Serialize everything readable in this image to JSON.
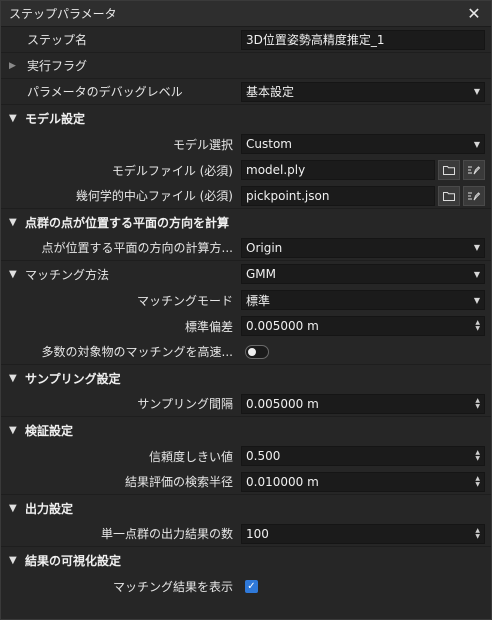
{
  "window": {
    "title": "ステップパラメータ"
  },
  "top": {
    "step_name": {
      "label": "ステップ名",
      "value": "3D位置姿勢高精度推定_1"
    },
    "exec_flag": {
      "label": "実行フラグ"
    },
    "debug_level": {
      "label": "パラメータのデバッグレベル",
      "value": "基本設定"
    }
  },
  "model": {
    "header": "モデル設定",
    "select": {
      "label": "モデル選択",
      "value": "Custom"
    },
    "file": {
      "label": "モデルファイル (必須)",
      "value": "model.ply"
    },
    "center": {
      "label": "幾何学的中心ファイル (必須)",
      "value": "pickpoint.json"
    }
  },
  "plane": {
    "header": "点群の点が位置する平面の方向を計算",
    "method": {
      "label": "点が位置する平面の方向の計算方...",
      "value": "Origin"
    }
  },
  "matching": {
    "label": "マッチング方法",
    "value": "GMM",
    "mode": {
      "label": "マッチングモード",
      "value": "標準"
    },
    "stddev": {
      "label": "標準偏差",
      "value": "0.005000 m"
    },
    "fast": {
      "label": "多数の対象物のマッチングを高速..."
    }
  },
  "sampling": {
    "header": "サンプリング設定",
    "interval": {
      "label": "サンプリング間隔",
      "value": "0.005000 m"
    }
  },
  "verify": {
    "header": "検証設定",
    "threshold": {
      "label": "信頼度しきい値",
      "value": "0.500"
    },
    "radius": {
      "label": "結果評価の検索半径",
      "value": "0.010000 m"
    }
  },
  "output": {
    "header": "出力設定",
    "count": {
      "label": "単一点群の出力結果の数",
      "value": "100"
    }
  },
  "visual": {
    "header": "結果の可視化設定",
    "show": {
      "label": "マッチング結果を表示"
    }
  },
  "colors": {
    "accent": "#2f79d9",
    "bg": "#262626",
    "field": "#1b1b1b"
  }
}
